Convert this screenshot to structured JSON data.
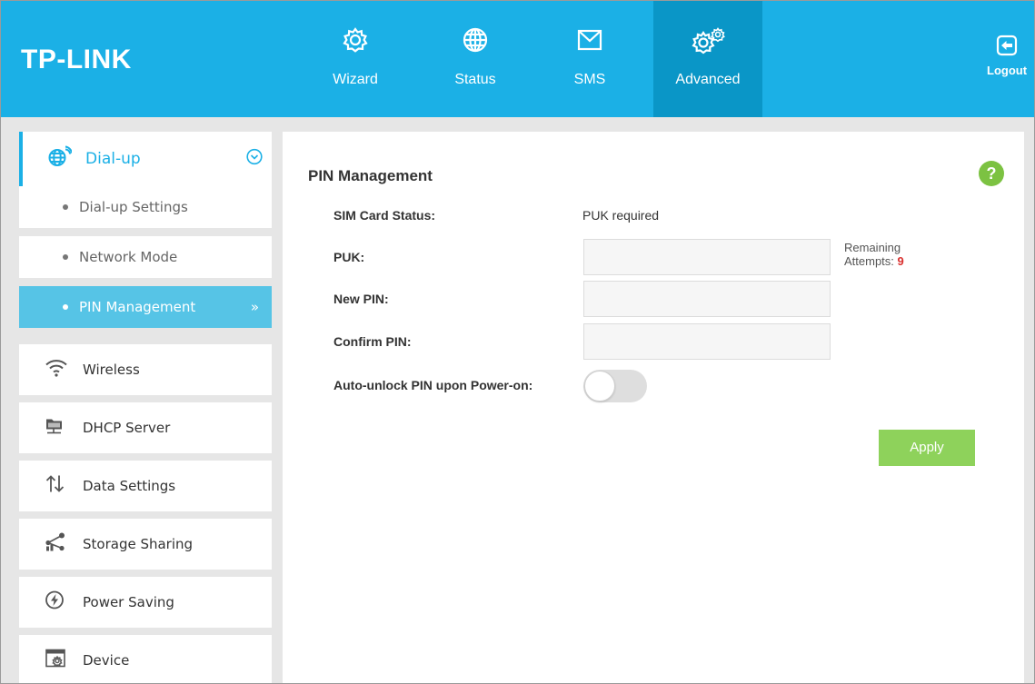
{
  "brand": {
    "logo_text": "TP-LINK",
    "accent": "#1bb0e6",
    "active_tab_bg": "#0a96c7"
  },
  "nav": {
    "tabs": [
      {
        "label": "Wizard",
        "icon": "gear-icon"
      },
      {
        "label": "Status",
        "icon": "globe-icon"
      },
      {
        "label": "SMS",
        "icon": "envelope-icon"
      },
      {
        "label": "Advanced",
        "icon": "gears-icon",
        "active": true
      }
    ],
    "logout_label": "Logout"
  },
  "sidebar": {
    "dialup": {
      "label": "Dial-up",
      "icon": "globe-signal-icon",
      "expanded": true,
      "items": [
        {
          "label": "Dial-up Settings"
        },
        {
          "label": "Network Mode"
        },
        {
          "label": "PIN Management",
          "active": true
        }
      ]
    },
    "sections": [
      {
        "label": "Wireless",
        "icon": "wifi-icon"
      },
      {
        "label": "DHCP Server",
        "icon": "dhcp-server-icon"
      },
      {
        "label": "Data Settings",
        "icon": "up-down-arrows-icon"
      },
      {
        "label": "Storage Sharing",
        "icon": "share-icon"
      },
      {
        "label": "Power Saving",
        "icon": "power-bolt-icon"
      },
      {
        "label": "Device",
        "icon": "device-settings-icon"
      }
    ]
  },
  "main": {
    "title": "PIN Management",
    "help_label": "?",
    "sim_status_label": "SIM Card Status:",
    "sim_status_value": "PUK required",
    "puk_label": "PUK:",
    "puk_value": "",
    "remaining_label": "Remaining",
    "attempts_label": "Attempts:",
    "attempts_count": "9",
    "new_pin_label": "New PIN:",
    "new_pin_value": "",
    "confirm_pin_label": "Confirm PIN:",
    "confirm_pin_value": "",
    "auto_unlock_label": "Auto-unlock PIN upon Power-on:",
    "auto_unlock_on": false,
    "apply_label": "Apply",
    "apply_color": "#8ed25b",
    "attempts_color": "#d9302e"
  }
}
